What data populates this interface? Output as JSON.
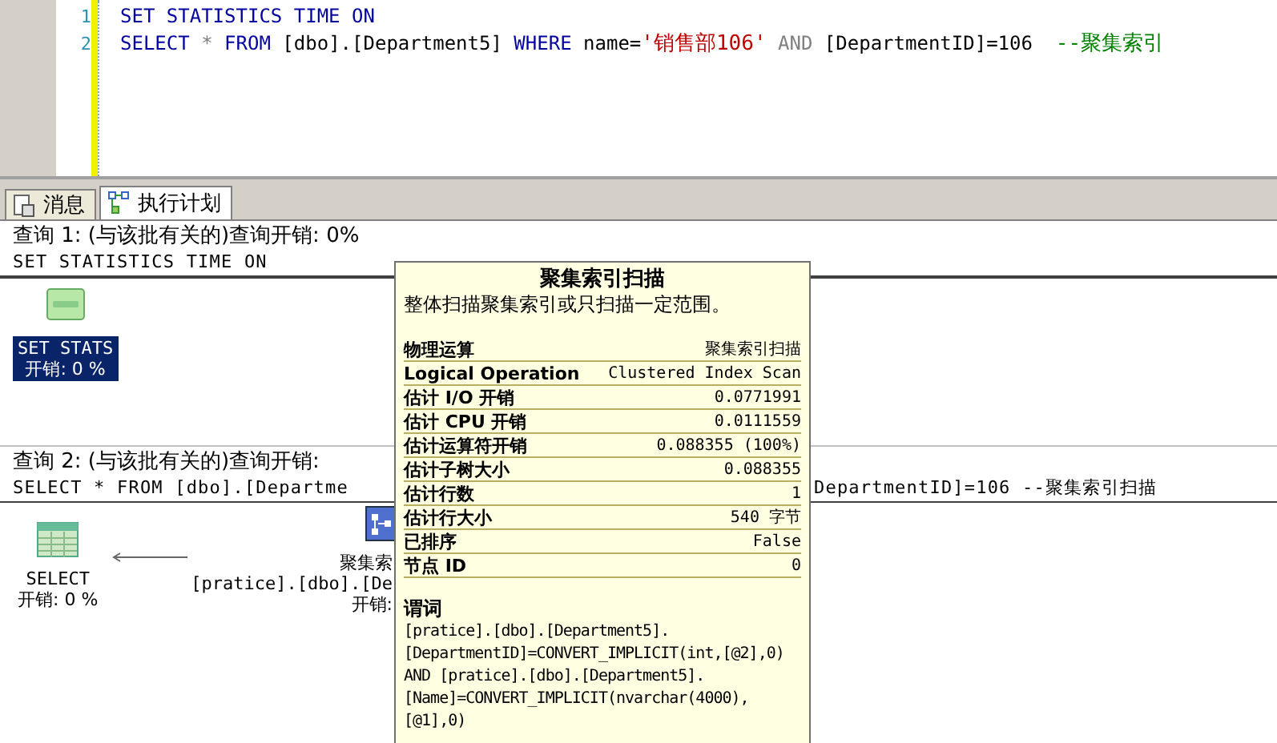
{
  "editor": {
    "lines": [
      {
        "number": "1",
        "tokens": [
          {
            "kind": "keyword",
            "text": "SET STATISTICS TIME ON"
          }
        ]
      },
      {
        "number": "2",
        "tokens": [
          {
            "kind": "keyword",
            "text": "SELECT"
          },
          {
            "kind": "operator",
            "text": " * "
          },
          {
            "kind": "keyword",
            "text": "FROM"
          },
          {
            "kind": "plain",
            "text": " [dbo].[Department5] "
          },
          {
            "kind": "keyword",
            "text": "WHERE"
          },
          {
            "kind": "plain",
            "text": " name="
          },
          {
            "kind": "string",
            "text": "'销售部106'"
          },
          {
            "kind": "operator",
            "text": " AND "
          },
          {
            "kind": "plain",
            "text": "[DepartmentID]=106  "
          },
          {
            "kind": "comment",
            "text": "--聚集索引"
          }
        ]
      }
    ]
  },
  "tabs": [
    {
      "label": "消息",
      "kind": "document",
      "selected": false
    },
    {
      "label": "执行计划",
      "kind": "plan",
      "selected": true
    }
  ],
  "queries": [
    {
      "header": "查询 1: (与该批有关的)查询开销: 0%",
      "sql": "SET STATISTICS TIME ON",
      "nodes": [
        {
          "kind": "tsql",
          "lines": [
            "SET STATS",
            "开销: 0 %"
          ],
          "selected": true
        }
      ]
    },
    {
      "header": "查询 2: (与该批有关的)查询开销:",
      "sql": "SELECT * FROM [dbo].[Departme",
      "sql_tail": "DepartmentID]=106 --聚集索引扫描",
      "nodes": [
        {
          "kind": "select",
          "lines": [
            "SELECT",
            "开销: 0 %"
          ],
          "selected": false
        },
        {
          "kind": "arrow"
        },
        {
          "kind": "clustered_scan",
          "lines": [
            "聚集索",
            "[pratice].[dbo].[De",
            "开销:"
          ],
          "selected": false
        }
      ]
    }
  ],
  "tooltip": {
    "title": "聚集索引扫描",
    "description": "整体扫描聚集索引或只扫描一定范围。",
    "rows": [
      {
        "label": "物理运算",
        "value": "聚集索引扫描"
      },
      {
        "label": "Logical Operation",
        "value": "Clustered Index Scan"
      },
      {
        "label": "估计 I/O 开销",
        "value": "0.0771991"
      },
      {
        "label": "估计 CPU 开销",
        "value": "0.0111559"
      },
      {
        "label": "估计运算符开销",
        "value": "0.088355 (100%)"
      },
      {
        "label": "估计子树大小",
        "value": "0.088355"
      },
      {
        "label": "估计行数",
        "value": "1"
      },
      {
        "label": "估计行大小",
        "value": "540 字节"
      },
      {
        "label": "已排序",
        "value": "False"
      },
      {
        "label": "节点 ID",
        "value": "0"
      }
    ],
    "predicate_label": "谓词",
    "predicate": "[pratice].[dbo].[Department5].[DepartmentID]=CONVERT_IMPLICIT(int,[@2],0) AND [pratice].[dbo].[Department5].[Name]=CONVERT_IMPLICIT(nvarchar(4000),[@1],0)"
  }
}
